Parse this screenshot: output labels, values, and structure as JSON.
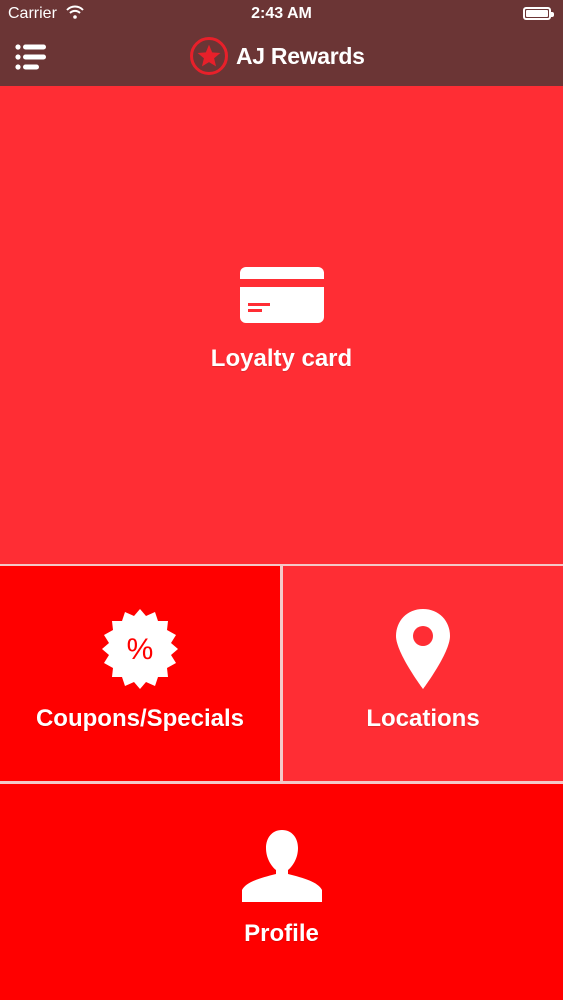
{
  "status_bar": {
    "carrier": "Carrier",
    "time": "2:43 AM",
    "wifi_icon": "wifi-icon",
    "battery_icon": "battery-icon"
  },
  "header": {
    "title": "AJ Rewards",
    "menu_icon": "menu-icon",
    "logo_icon": "star-icon",
    "background_color": "#6b3535",
    "logo_color": "#e8202a"
  },
  "tiles": {
    "loyalty": {
      "label": "Loyalty card",
      "icon": "credit-card-icon",
      "color": "#ff2d34"
    },
    "coupons": {
      "label": "Coupons/Specials",
      "icon": "percent-badge-icon",
      "color": "#ff0000"
    },
    "locations": {
      "label": "Locations",
      "icon": "map-pin-icon",
      "color": "#ff2d34"
    },
    "profile": {
      "label": "Profile",
      "icon": "person-icon",
      "color": "#ff0000"
    }
  }
}
